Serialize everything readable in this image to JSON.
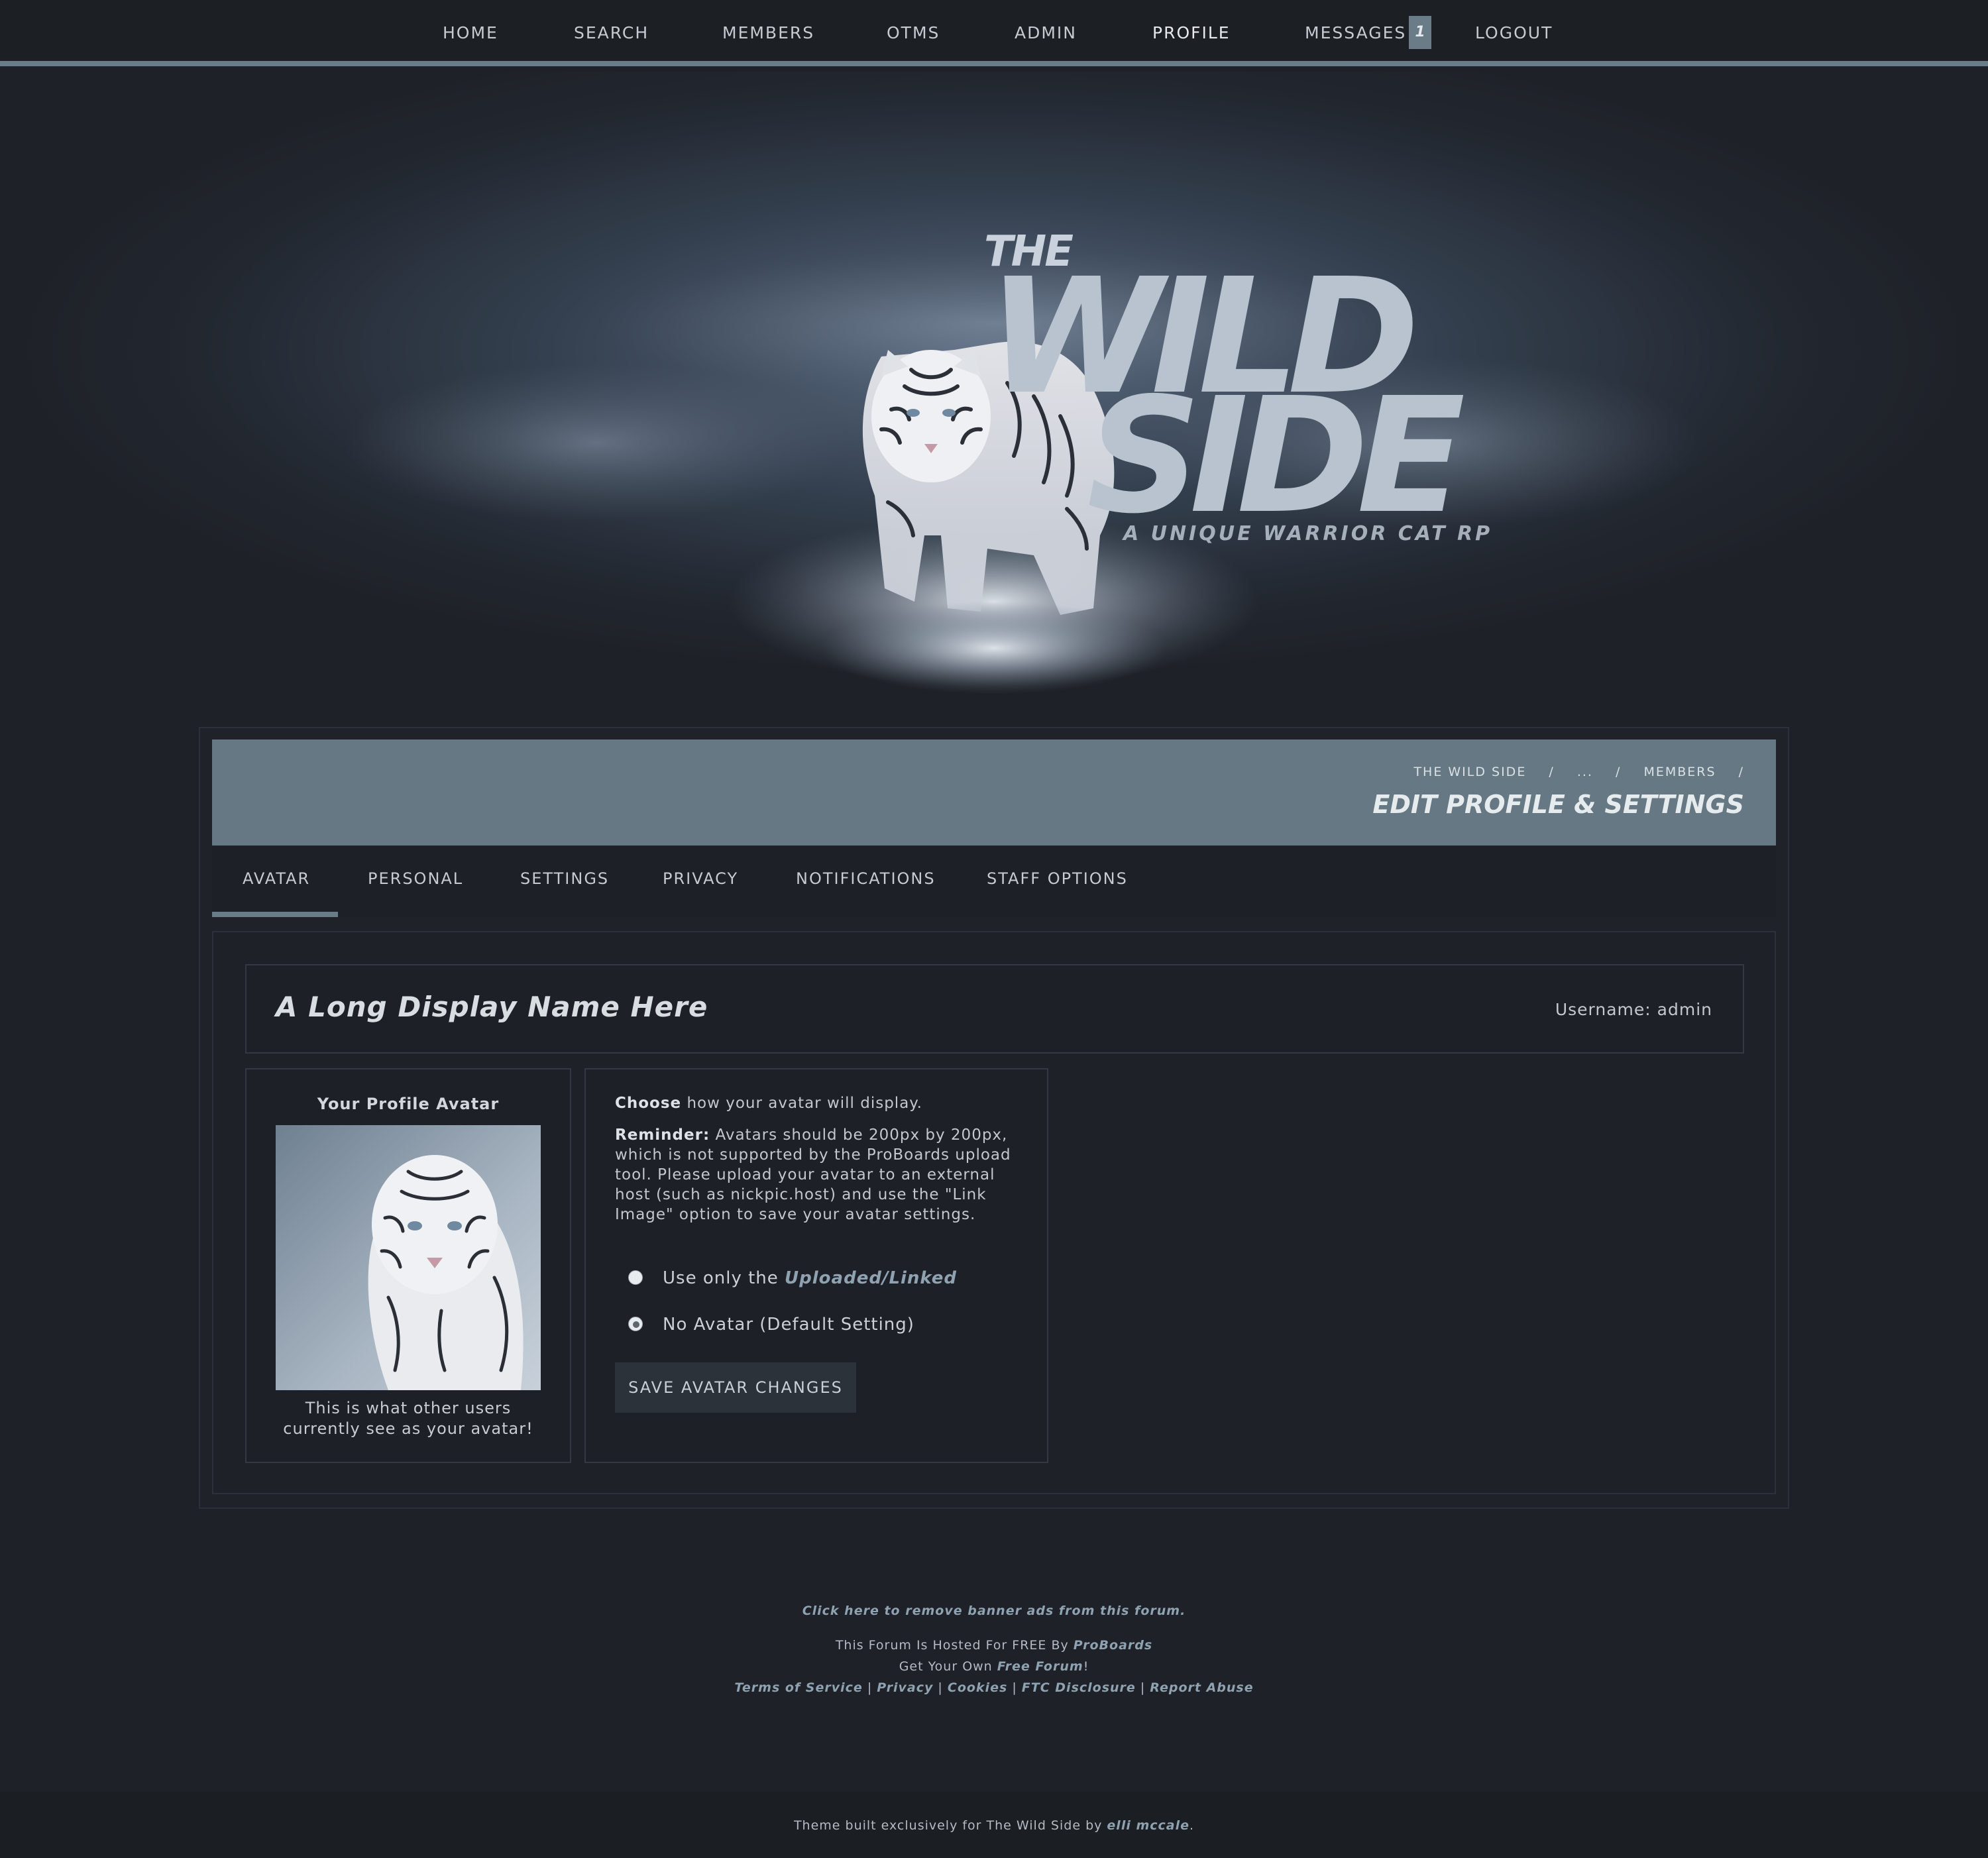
{
  "nav": {
    "items": [
      {
        "label": "HOME"
      },
      {
        "label": "SEARCH"
      },
      {
        "label": "MEMBERS"
      },
      {
        "label": "OTMS"
      },
      {
        "label": "ADMIN"
      },
      {
        "label": "PROFILE"
      },
      {
        "label": "MESSAGES"
      },
      {
        "label": "LOGOUT"
      }
    ],
    "messages_badge": "1",
    "active": "PROFILE"
  },
  "banner": {
    "logo_the": "THE",
    "logo_wild": "WILD",
    "logo_side": "SIDE",
    "tagline": "A UNIQUE WARRIOR CAT RP"
  },
  "header": {
    "breadcrumbs": [
      "THE WILD SIDE",
      "/",
      "...",
      "/",
      "MEMBERS",
      "/"
    ],
    "title": "EDIT PROFILE & SETTINGS"
  },
  "tabs": {
    "items": [
      {
        "label": "AVATAR"
      },
      {
        "label": "PERSONAL"
      },
      {
        "label": "SETTINGS"
      },
      {
        "label": "PRIVACY"
      },
      {
        "label": "NOTIFICATIONS"
      },
      {
        "label": "STAFF OPTIONS"
      }
    ],
    "active": "AVATAR"
  },
  "profile": {
    "display_name": "A Long Display Name Here",
    "username_label": "Username:",
    "username": "admin"
  },
  "avatar_panel": {
    "title": "Your Profile Avatar",
    "caption_line1": "This is what other users",
    "caption_line2": "currently see as your avatar!"
  },
  "options_panel": {
    "choose_bold": "Choose",
    "choose_rest": "how your avatar will display.",
    "reminder_bold": "Reminder:",
    "reminder_rest": "Avatars should be 200px by 200px, which is not supported by the ProBoards upload tool. Please upload your avatar to an external host (such as nickpic.host) and use the \"Link Image\" option to save your avatar settings.",
    "radio1_prefix": "Use only the",
    "radio1_link": "Uploaded/Linked",
    "radio2_label": "No Avatar (Default Setting)",
    "selected": "No Avatar (Default Setting)",
    "save_label": "SAVE AVATAR CHANGES"
  },
  "footer": {
    "remove_ads": "Click here to remove banner ads from this forum.",
    "hosted_prefix": "This Forum Is Hosted For FREE By",
    "hosted_link": "ProBoards",
    "own_prefix": "Get Your Own",
    "own_link": "Free Forum",
    "own_suffix": "!",
    "links": [
      "Terms of Service",
      "Privacy",
      "Cookies",
      "FTC Disclosure",
      "Report Abuse"
    ],
    "separator": "|",
    "theme_prefix": "Theme built exclusively for The Wild Side by",
    "theme_author": "elli mccale",
    "theme_suffix": "."
  },
  "colors": {
    "background": "#1e2127",
    "accent": "#6a7c88",
    "link": "#8ea2b1",
    "header_bar": "#667883"
  }
}
